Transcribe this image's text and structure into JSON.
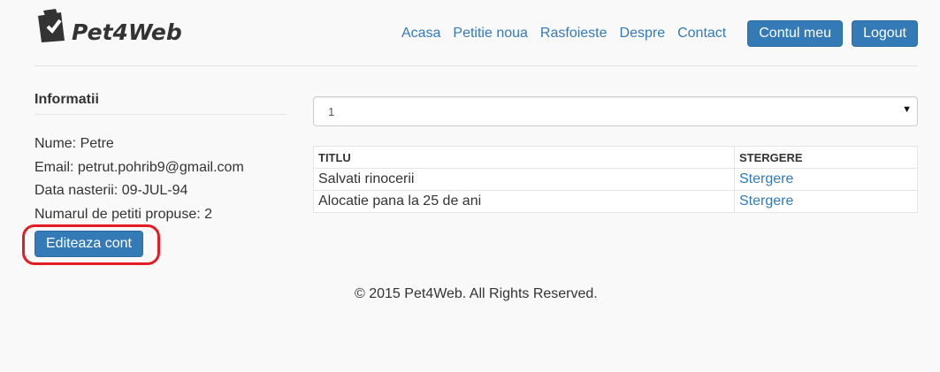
{
  "brand": {
    "name": "Pet4Web"
  },
  "nav": {
    "links": [
      "Acasa",
      "Petitie noua",
      "Rasfoieste",
      "Despre",
      "Contact"
    ],
    "account_button": "Contul meu",
    "logout_button": "Logout"
  },
  "sidebar": {
    "title": "Informatii",
    "lines": [
      "Nume: Petre",
      "Email: petrut.pohrib9@gmail.com",
      "Data nasterii: 09-JUL-94",
      "Numarul de petiti propuse: 2"
    ],
    "edit_button": "Editeaza cont"
  },
  "main": {
    "select_value": "1",
    "table": {
      "headers": [
        "TITLU",
        "STERGERE"
      ],
      "rows": [
        {
          "title": "Salvati rinocerii",
          "action": "Stergere"
        },
        {
          "title": "Alocatie pana la 25 de ani",
          "action": "Stergere"
        }
      ]
    }
  },
  "footer": {
    "text": "© 2015 Pet4Web. All Rights Reserved."
  },
  "colors": {
    "link": "#337ab7",
    "button": "#337ab7",
    "highlight": "#e41c24"
  }
}
